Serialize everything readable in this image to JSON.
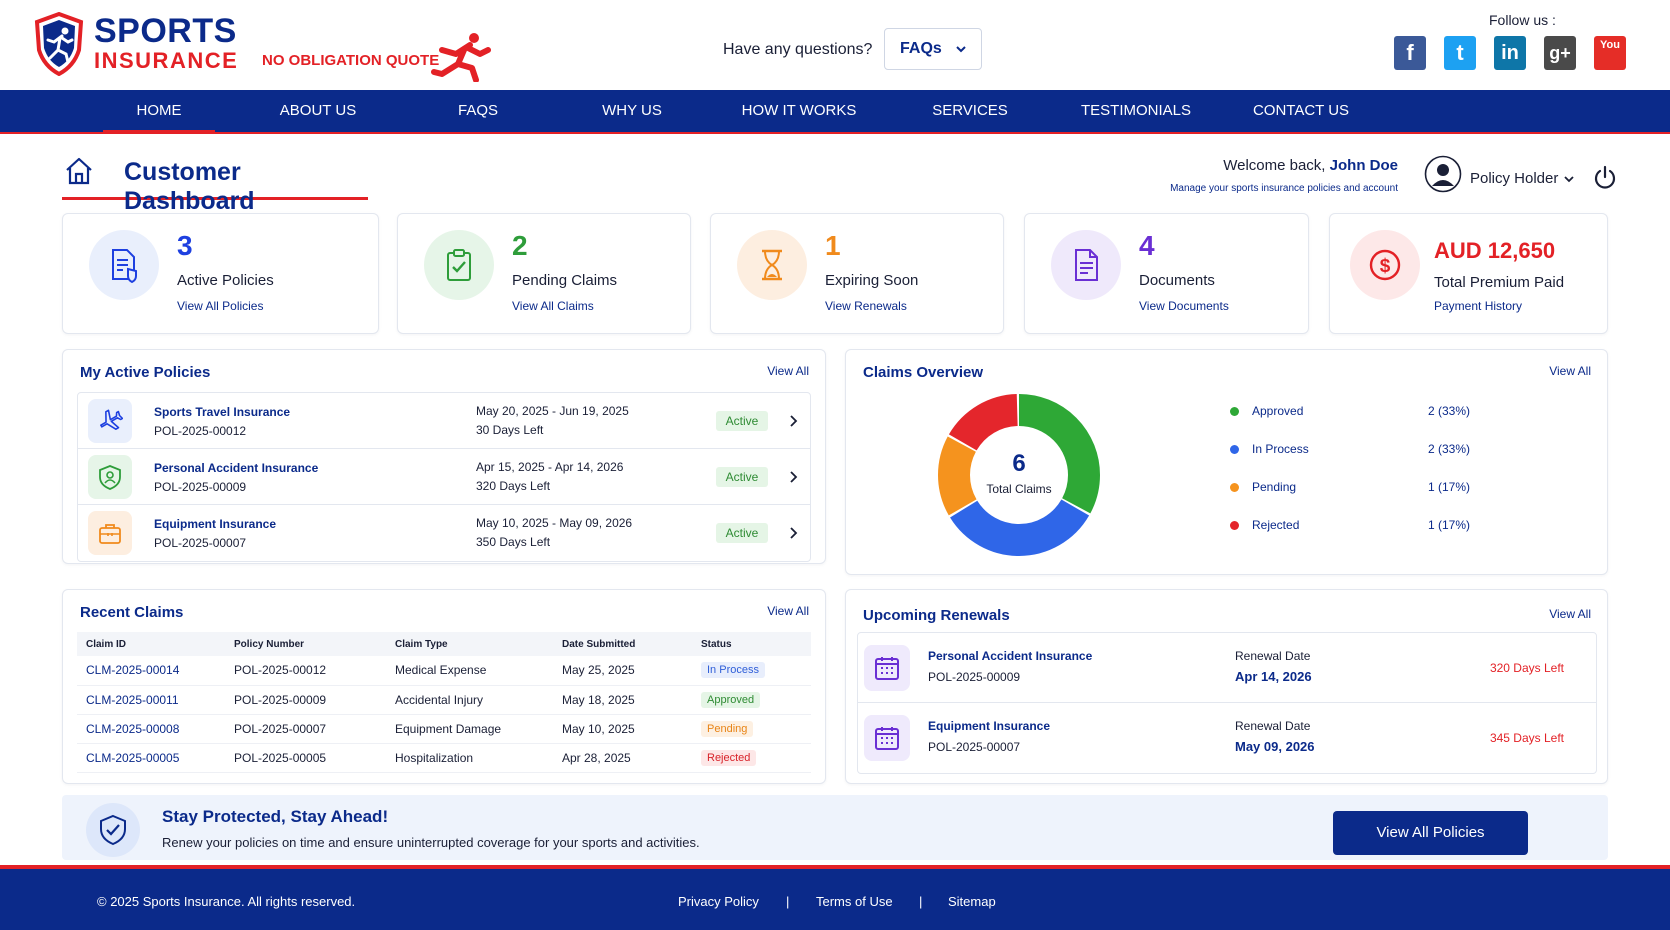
{
  "header": {
    "logo_top": "SPORTS",
    "logo_bottom": "INSURANCE",
    "quote": "NO OBLIGATION QUOTE",
    "question": "Have any questions?",
    "faq_dropdown": "FAQs",
    "follow_label": "Follow us :",
    "socials": [
      {
        "name": "facebook",
        "glyph": "f",
        "color": "#3b5998"
      },
      {
        "name": "twitter",
        "glyph": "t",
        "color": "#1da1f2"
      },
      {
        "name": "linkedin",
        "glyph": "in",
        "color": "#0e76a8"
      },
      {
        "name": "google-plus",
        "glyph": "g+",
        "color": "#4a4a4a"
      },
      {
        "name": "youtube",
        "glyph": "You",
        "color": "#e52d27"
      }
    ]
  },
  "nav": {
    "items": [
      "HOME",
      "ABOUT US",
      "FAQS",
      "WHY US",
      "HOW IT WORKS",
      "SERVICES",
      "TESTIMONIALS",
      "CONTACT US"
    ],
    "active": "HOME"
  },
  "dashboard": {
    "title": "Customer Dashboard",
    "welcome_prefix": "Welcome back, ",
    "user_name": "John Doe",
    "welcome_sub": "Manage your sports insurance policies and account",
    "role": "Policy Holder"
  },
  "stats": [
    {
      "value": "3",
      "label": "Active Policies",
      "link": "View All Policies",
      "color": "#1e40e0",
      "bg": "#e9effc",
      "icon": "policy-document-icon"
    },
    {
      "value": "2",
      "label": "Pending Claims",
      "link": "View All Claims",
      "color": "#2e9d3a",
      "bg": "#e6f5e8",
      "icon": "clipboard-check-icon"
    },
    {
      "value": "1",
      "label": "Expiring Soon",
      "link": "View Renewals",
      "color": "#f08a1c",
      "bg": "#fdeee0",
      "icon": "hourglass-icon"
    },
    {
      "value": "4",
      "label": "Documents",
      "link": "View Documents",
      "color": "#6a2fd4",
      "bg": "#efe9fb",
      "icon": "document-icon"
    },
    {
      "value": "AUD 12,650",
      "label": "Total Premium Paid",
      "link": "Payment History",
      "color": "#e32126",
      "bg": "#fde8e8",
      "icon": "dollar-icon"
    }
  ],
  "active_policies": {
    "title": "My Active Policies",
    "view_all": "View All",
    "items": [
      {
        "name": "Sports Travel Insurance",
        "number": "POL-2025-00012",
        "dates": "May 20, 2025 - Jun 19, 2025",
        "days": "30 Days Left",
        "status": "Active",
        "icon": "airplane-icon"
      },
      {
        "name": "Personal Accident Insurance",
        "number": "POL-2025-00009",
        "dates": "Apr 15, 2025 - Apr 14, 2026",
        "days": "320 Days Left",
        "status": "Active",
        "icon": "shield-person-icon"
      },
      {
        "name": "Equipment Insurance",
        "number": "POL-2025-00007",
        "dates": "May 10, 2025 - May 09, 2026",
        "days": "350 Days Left",
        "status": "Active",
        "icon": "briefcase-icon"
      }
    ]
  },
  "claims_overview": {
    "title": "Claims Overview",
    "view_all": "View All",
    "total": "6",
    "total_label": "Total Claims"
  },
  "chart_data": {
    "type": "pie",
    "categories": [
      "Approved",
      "In Process",
      "Pending",
      "Rejected"
    ],
    "values": [
      2,
      2,
      1,
      1
    ],
    "value_labels": [
      "2 (33%)",
      "2 (33%)",
      "1 (17%)",
      "1 (17%)"
    ],
    "colors": [
      "#2ea836",
      "#2f66e8",
      "#f5931e",
      "#e4262c"
    ],
    "legend": "right"
  },
  "recent_claims": {
    "title": "Recent Claims",
    "view_all": "View All",
    "columns": [
      "Claim ID",
      "Policy Number",
      "Claim Type",
      "Date Submitted",
      "Status"
    ],
    "rows": [
      [
        "CLM-2025-00014",
        "POL-2025-00012",
        "Medical Expense",
        "May 25, 2025",
        "In Process"
      ],
      [
        "CLM-2025-00011",
        "POL-2025-00009",
        "Accidental Injury",
        "May 18, 2025",
        "Approved"
      ],
      [
        "CLM-2025-00008",
        "POL-2025-00007",
        "Equipment Damage",
        "May 10, 2025",
        "Pending"
      ],
      [
        "CLM-2025-00005",
        "POL-2025-00005",
        "Hospitalization",
        "Apr 28, 2025",
        "Rejected"
      ]
    ],
    "status_colors": {
      "In Process": {
        "fg": "#2f5ed8",
        "bg": "#e8eefc"
      },
      "Approved": {
        "fg": "#2e8b33",
        "bg": "#e5f5e6"
      },
      "Pending": {
        "fg": "#e88416",
        "bg": "#fdf0e2"
      },
      "Rejected": {
        "fg": "#d8232a",
        "bg": "#fde7e7"
      }
    }
  },
  "renewals": {
    "title": "Upcoming Renewals",
    "view_all": "View All",
    "items": [
      {
        "name": "Personal Accident Insurance",
        "number": "POL-2025-00009",
        "label": "Renewal Date",
        "date": "Apr 14, 2026",
        "left": "320 Days Left"
      },
      {
        "name": "Equipment Insurance",
        "number": "POL-2025-00007",
        "label": "Renewal Date",
        "date": "May 09, 2026",
        "left": "345 Days Left"
      }
    ]
  },
  "banner": {
    "title": "Stay Protected, Stay Ahead!",
    "subtitle": "Renew your policies on time and ensure uninterrupted coverage for your sports and activities.",
    "button": "View All Policies"
  },
  "footer": {
    "copyright": "© 2025 Sports Insurance. All rights reserved.",
    "links": [
      "Privacy Policy",
      "Terms of Use",
      "Sitemap"
    ],
    "separator": "|"
  }
}
